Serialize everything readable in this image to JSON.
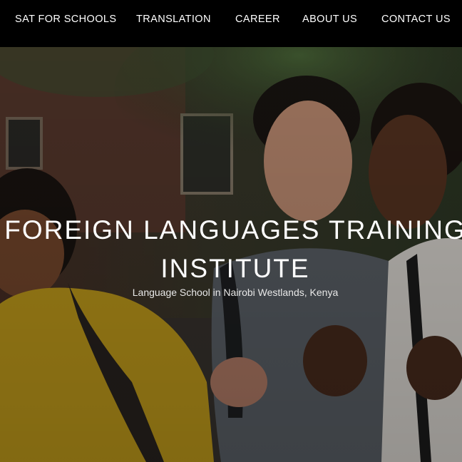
{
  "nav": {
    "items": [
      {
        "label": "SAT FOR SCHOOLS"
      },
      {
        "label": "TRANSLATION"
      },
      {
        "label": "CAREER"
      },
      {
        "label": "ABOUT US"
      },
      {
        "label": "CONTACT US"
      }
    ]
  },
  "hero": {
    "title": "FOREIGN LANGUAGES TRAINING INSTITUTE",
    "subtitle": "Language School in Nairobi Westlands, Kenya"
  },
  "colors": {
    "nav_bg": "#000000",
    "text": "#ffffff",
    "yellow_shirt": "#c9a21c",
    "grey_shirt": "#5e646b"
  }
}
